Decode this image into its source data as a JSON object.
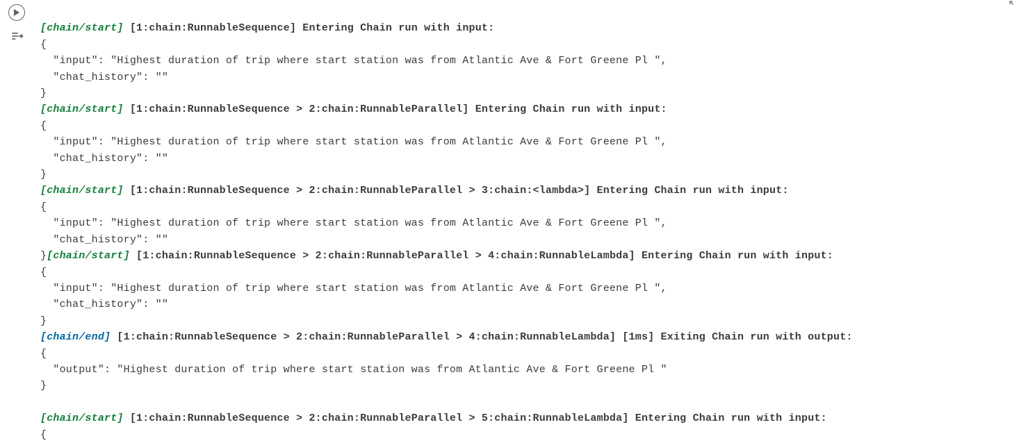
{
  "common": {
    "input_line": "  \"input\": \"Highest duration of trip where start station was from Atlantic Ave & Fort Greene Pl \",",
    "chat_history_line": "  \"chat_history\": \"\"",
    "output_line": "  \"output\": \"Highest duration of trip where start station was from Atlantic Ave & Fort Greene Pl \"",
    "open_brace": "{",
    "close_brace": "}",
    "close_open": "}"
  },
  "lines": [
    {
      "tag": "[chain/start]",
      "tagClass": "tag-start",
      "chain": " [1:chain:RunnableSequence] ",
      "tail": "Entering Chain run with input:"
    },
    {
      "tag": "[chain/start]",
      "tagClass": "tag-start",
      "chain": " [1:chain:RunnableSequence > 2:chain:RunnableParallel] ",
      "tail": "Entering Chain run with input:"
    },
    {
      "tag": "[chain/start]",
      "tagClass": "tag-start",
      "chain": " [1:chain:RunnableSequence > 2:chain:RunnableParallel > 3:chain:<lambda>] ",
      "tail": "Entering Chain run with input:"
    },
    {
      "tag": "[chain/start]",
      "tagClass": "tag-start",
      "chain": " [1:chain:RunnableSequence > 2:chain:RunnableParallel > 4:chain:RunnableLambda] ",
      "tail": "Entering Chain run with input:"
    },
    {
      "tag": "[chain/end]",
      "tagClass": "tag-end",
      "chain": " [1:chain:RunnableSequence > 2:chain:RunnableParallel > 4:chain:RunnableLambda] [1ms] ",
      "tail": "Exiting Chain run with output:"
    },
    {
      "tag": "[chain/start]",
      "tagClass": "tag-start",
      "chain": " [1:chain:RunnableSequence > 2:chain:RunnableParallel > 5:chain:RunnableLambda] ",
      "tail": "Entering Chain run with input:"
    }
  ]
}
